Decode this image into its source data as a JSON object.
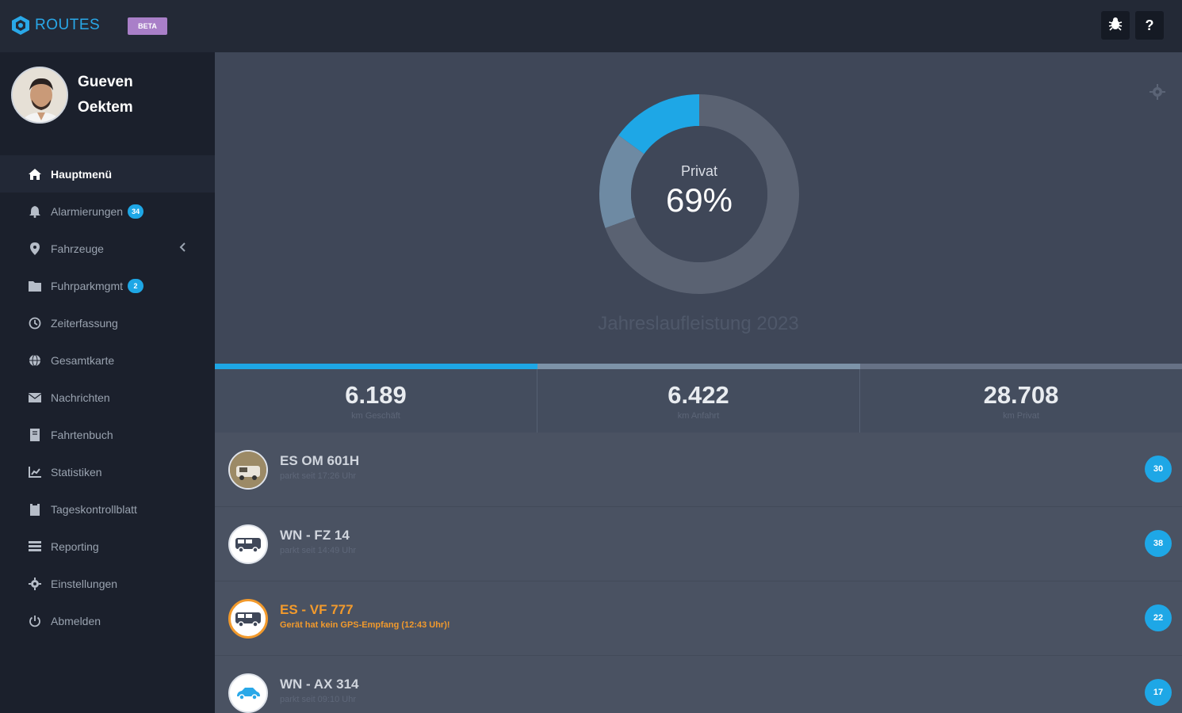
{
  "header": {
    "app_name": "ROUTES",
    "beta_label": "BETA",
    "bug_icon": "bug-icon",
    "help_label": "?"
  },
  "profile": {
    "first_name": "Gueven",
    "last_name": "Oektem"
  },
  "sidebar": {
    "items": [
      {
        "label": "Hauptmenü",
        "icon": "home-icon",
        "active": true
      },
      {
        "label": "Alarmierungen",
        "icon": "bell-icon",
        "badge": "34"
      },
      {
        "label": "Fahrzeuge",
        "icon": "map-pin-icon",
        "chevron": true
      },
      {
        "label": "Fuhrparkmgmt",
        "icon": "folder-icon",
        "badge": "2"
      },
      {
        "label": "Zeiterfassung",
        "icon": "clock-icon"
      },
      {
        "label": "Gesamtkarte",
        "icon": "globe-icon"
      },
      {
        "label": "Nachrichten",
        "icon": "message-icon"
      },
      {
        "label": "Fahrtenbuch",
        "icon": "book-icon"
      },
      {
        "label": "Statistiken",
        "icon": "chart-icon"
      },
      {
        "label": "Tageskontrollblatt",
        "icon": "clipboard-icon"
      },
      {
        "label": "Reporting",
        "icon": "report-icon"
      },
      {
        "label": "Einstellungen",
        "icon": "gear-icon"
      },
      {
        "label": "Abmelden",
        "icon": "power-icon"
      }
    ]
  },
  "chart_data": {
    "type": "pie",
    "center_label": "Privat",
    "center_value": "69%",
    "title": "Jahreslaufleistung 2023",
    "categories": [
      "Geschäft",
      "Anfahrt",
      "Privat"
    ],
    "values": [
      6189,
      6422,
      28708
    ],
    "colors": [
      "#1ea7e6",
      "#6e8aa3",
      "#5a6272"
    ]
  },
  "stats": [
    {
      "value": "6.189",
      "label": "km Geschäft"
    },
    {
      "value": "6.422",
      "label": "km Anfahrt"
    },
    {
      "value": "28.708",
      "label": "km Privat"
    }
  ],
  "progress": {
    "segments": [
      {
        "fraction": 0.3333,
        "color": "#1ea7e6"
      },
      {
        "fraction": 0.3333,
        "color": "#7d93a8"
      },
      {
        "fraction": 0.3334,
        "color": "#677286"
      }
    ]
  },
  "vehicles": [
    {
      "plate": "ES OM 601H",
      "status": "parkt seit 17:26 Uhr",
      "count": "30",
      "icon": "vehicle-photo-icon",
      "warning": false
    },
    {
      "plate": "WN - FZ 14",
      "status": "parkt seit 14:49 Uhr",
      "count": "38",
      "icon": "van-icon",
      "warning": false
    },
    {
      "plate": "ES - VF 777",
      "status": "Gerät hat kein GPS-Empfang (12:43 Uhr)!",
      "count": "22",
      "icon": "van-icon",
      "warning": true
    },
    {
      "plate": "WN - AX 314",
      "status": "parkt seit 09:10 Uhr",
      "count": "17",
      "icon": "car-icon",
      "warning": false
    }
  ],
  "colors": {
    "accent": "#1ea7e6",
    "warning": "#f29a2c",
    "beta": "#a97fc8"
  }
}
